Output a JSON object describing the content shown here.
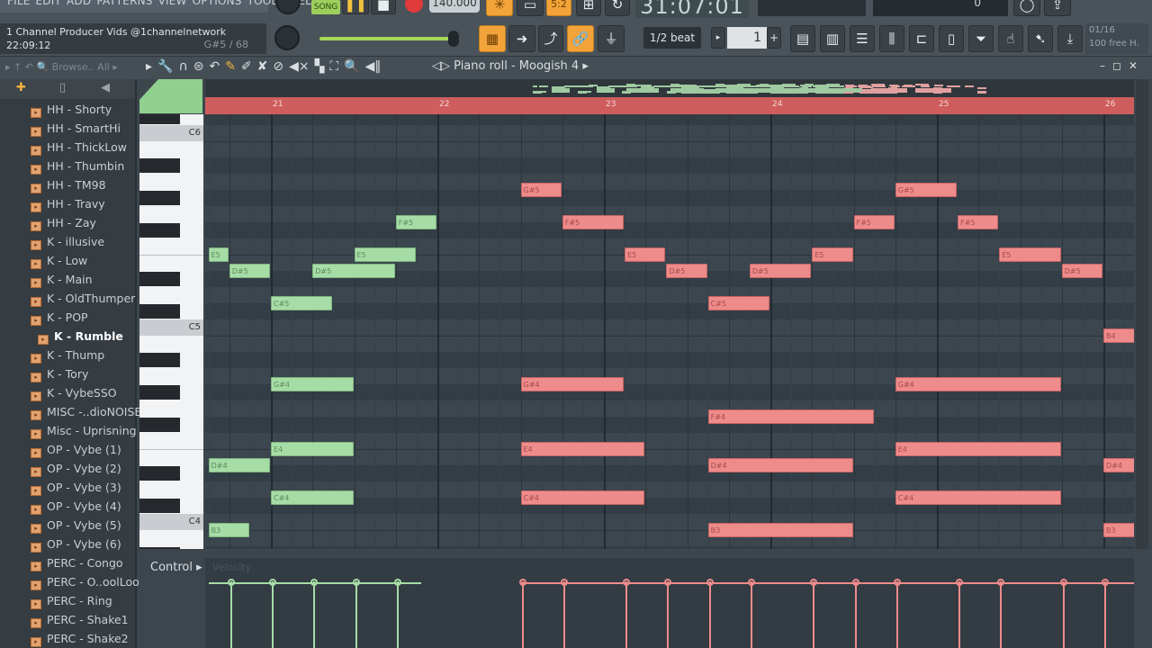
{
  "menu": [
    "FILE",
    "EDIT",
    "ADD",
    "PATTERNS",
    "VIEW",
    "OPTIONS",
    "TOOLS",
    "HELP"
  ],
  "transport": {
    "mode": "SONG",
    "tempo": "140.000",
    "time": "31:07:01",
    "pattern_step": "5:2",
    "counter": "0"
  },
  "hint": {
    "line1": "1 Channel Producer Vids @1channelnetwork",
    "line2": "22:09:12",
    "note": "G#5 / 68"
  },
  "snap": "1/2 beat",
  "pattern_number": "1",
  "info": {
    "line1": "01/16",
    "line2": "100 free H."
  },
  "browser": {
    "header": "Browse.. All",
    "items": [
      "HH - Shorty",
      "HH - SmartHi",
      "HH - ThickLow",
      "HH - Thumbin",
      "HH - TM98",
      "HH - Travy",
      "HH - Zay",
      "K - illusive",
      "K - Low",
      "K - Main",
      "K - OldThumper",
      "K - POP",
      "K - Rumble",
      "K - Thump",
      "K - Tory",
      "K - VybeSSO",
      "MISC -..dioNOISE",
      "Misc - Uprisning",
      "OP - Vybe (1)",
      "OP - Vybe (2)",
      "OP - Vybe (3)",
      "OP - Vybe (4)",
      "OP - Vybe (5)",
      "OP - Vybe (6)",
      "PERC - Congo",
      "PERC - O..oolLoop",
      "PERC - Ring",
      "PERC - Shake1",
      "PERC - Shake2"
    ],
    "selected": "K - Rumble"
  },
  "piano_roll": {
    "title": "Piano roll - Moogish 4",
    "bars": [
      "21",
      "22",
      "23",
      "24",
      "25",
      "26"
    ],
    "octave_labels": [
      "C6",
      "C5",
      "C4"
    ],
    "control_label": "Control",
    "control_param": "Velocity",
    "colors": {
      "ghost": "#a6dca6",
      "active": "#ee8b8b",
      "ruler": "#cf5d5d"
    },
    "velocity": 0.78,
    "notes": [
      {
        "p": "E5",
        "s": 20.625,
        "l": 0.125,
        "c": "g"
      },
      {
        "p": "D#5",
        "s": 20.75,
        "l": 0.25,
        "c": "g"
      },
      {
        "p": "C#5",
        "s": 21,
        "l": 0.375,
        "c": "g"
      },
      {
        "p": "D#5",
        "s": 21.25,
        "l": 0.5,
        "c": "g"
      },
      {
        "p": "E5",
        "s": 21.5,
        "l": 0.375,
        "c": "g"
      },
      {
        "p": "F#5",
        "s": 21.75,
        "l": 0.25,
        "c": "g"
      },
      {
        "p": "G#4",
        "s": 21,
        "l": 0.5,
        "c": "g"
      },
      {
        "p": "E4",
        "s": 21,
        "l": 0.5,
        "c": "g"
      },
      {
        "p": "C#4",
        "s": 21,
        "l": 0.5,
        "c": "g"
      },
      {
        "p": "D#4",
        "s": 20.625,
        "l": 0.375,
        "c": "g"
      },
      {
        "p": "B3",
        "s": 20.625,
        "l": 0.25,
        "c": "g"
      },
      {
        "p": "G#5",
        "s": 22.5,
        "l": 0.25,
        "c": "r"
      },
      {
        "p": "F#5",
        "s": 22.75,
        "l": 0.375,
        "c": "r"
      },
      {
        "p": "E5",
        "s": 23.125,
        "l": 0.25,
        "c": "r"
      },
      {
        "p": "D#5",
        "s": 23.375,
        "l": 0.25,
        "c": "r"
      },
      {
        "p": "C#5",
        "s": 23.625,
        "l": 0.375,
        "c": "r"
      },
      {
        "p": "D#5",
        "s": 23.875,
        "l": 0.375,
        "c": "r"
      },
      {
        "p": "E5",
        "s": 24.25,
        "l": 0.25,
        "c": "r"
      },
      {
        "p": "F#5",
        "s": 24.5,
        "l": 0.25,
        "c": "r"
      },
      {
        "p": "G#5",
        "s": 24.75,
        "l": 0.375,
        "c": "r"
      },
      {
        "p": "F#5",
        "s": 25.125,
        "l": 0.25,
        "c": "r"
      },
      {
        "p": "E5",
        "s": 25.375,
        "l": 0.375,
        "c": "r"
      },
      {
        "p": "D#5",
        "s": 25.75,
        "l": 0.25,
        "c": "r"
      },
      {
        "p": "B4",
        "s": 26,
        "l": 0.25,
        "c": "r"
      },
      {
        "p": "G#4",
        "s": 22.5,
        "l": 0.625,
        "c": "r"
      },
      {
        "p": "G#4",
        "s": 24.75,
        "l": 1,
        "c": "r"
      },
      {
        "p": "F#4",
        "s": 23.625,
        "l": 1,
        "c": "r"
      },
      {
        "p": "E4",
        "s": 22.5,
        "l": 0.75,
        "c": "r"
      },
      {
        "p": "E4",
        "s": 24.75,
        "l": 1,
        "c": "r"
      },
      {
        "p": "D#4",
        "s": 23.625,
        "l": 0.875,
        "c": "r"
      },
      {
        "p": "D#4",
        "s": 26,
        "l": 0.25,
        "c": "r"
      },
      {
        "p": "C#4",
        "s": 22.5,
        "l": 0.75,
        "c": "r"
      },
      {
        "p": "C#4",
        "s": 24.75,
        "l": 1,
        "c": "r"
      },
      {
        "p": "B3",
        "s": 23.625,
        "l": 0.875,
        "c": "r"
      },
      {
        "p": "B3",
        "s": 26,
        "l": 0.25,
        "c": "r"
      }
    ]
  }
}
